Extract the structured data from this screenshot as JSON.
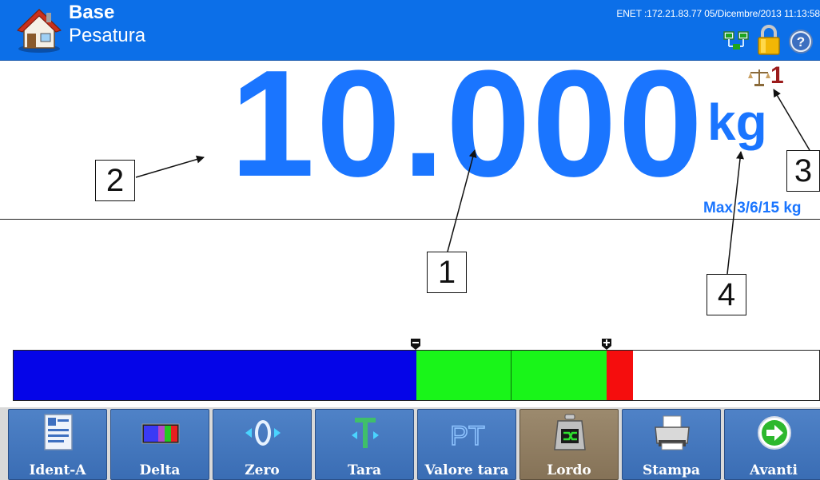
{
  "header": {
    "title": "Base",
    "subtitle": "Pesatura",
    "status": "ENET :172.21.83.77  05/Dicembre/2013 11:13:58",
    "icons": [
      "home-icon",
      "network-icon",
      "lock-icon",
      "help-icon"
    ]
  },
  "display": {
    "weight": "10.000",
    "unit": "kg",
    "scale_number": "1",
    "capacity": "Max 3/6/15 kg"
  },
  "callouts": [
    "1",
    "2",
    "3",
    "4"
  ],
  "bar": {
    "colors": {
      "under": "#0505e8",
      "ok": "#19f519",
      "over": "#f50d0d"
    },
    "minus_marker": "-",
    "plus_marker": "+"
  },
  "softkeys": [
    {
      "label": "Ident-A",
      "icon": "id-card-icon"
    },
    {
      "label": "Delta",
      "icon": "delta-bars-icon"
    },
    {
      "label": "Zero",
      "icon": "zero-icon"
    },
    {
      "label": "Tara",
      "icon": "tare-icon"
    },
    {
      "label": "Valore tara",
      "icon": "preset-tare-icon"
    },
    {
      "label": "Lordo",
      "icon": "gross-weight-icon",
      "active": true
    },
    {
      "label": "Stampa",
      "icon": "printer-icon"
    },
    {
      "label": "Avanti",
      "icon": "next-arrow-icon"
    }
  ]
}
